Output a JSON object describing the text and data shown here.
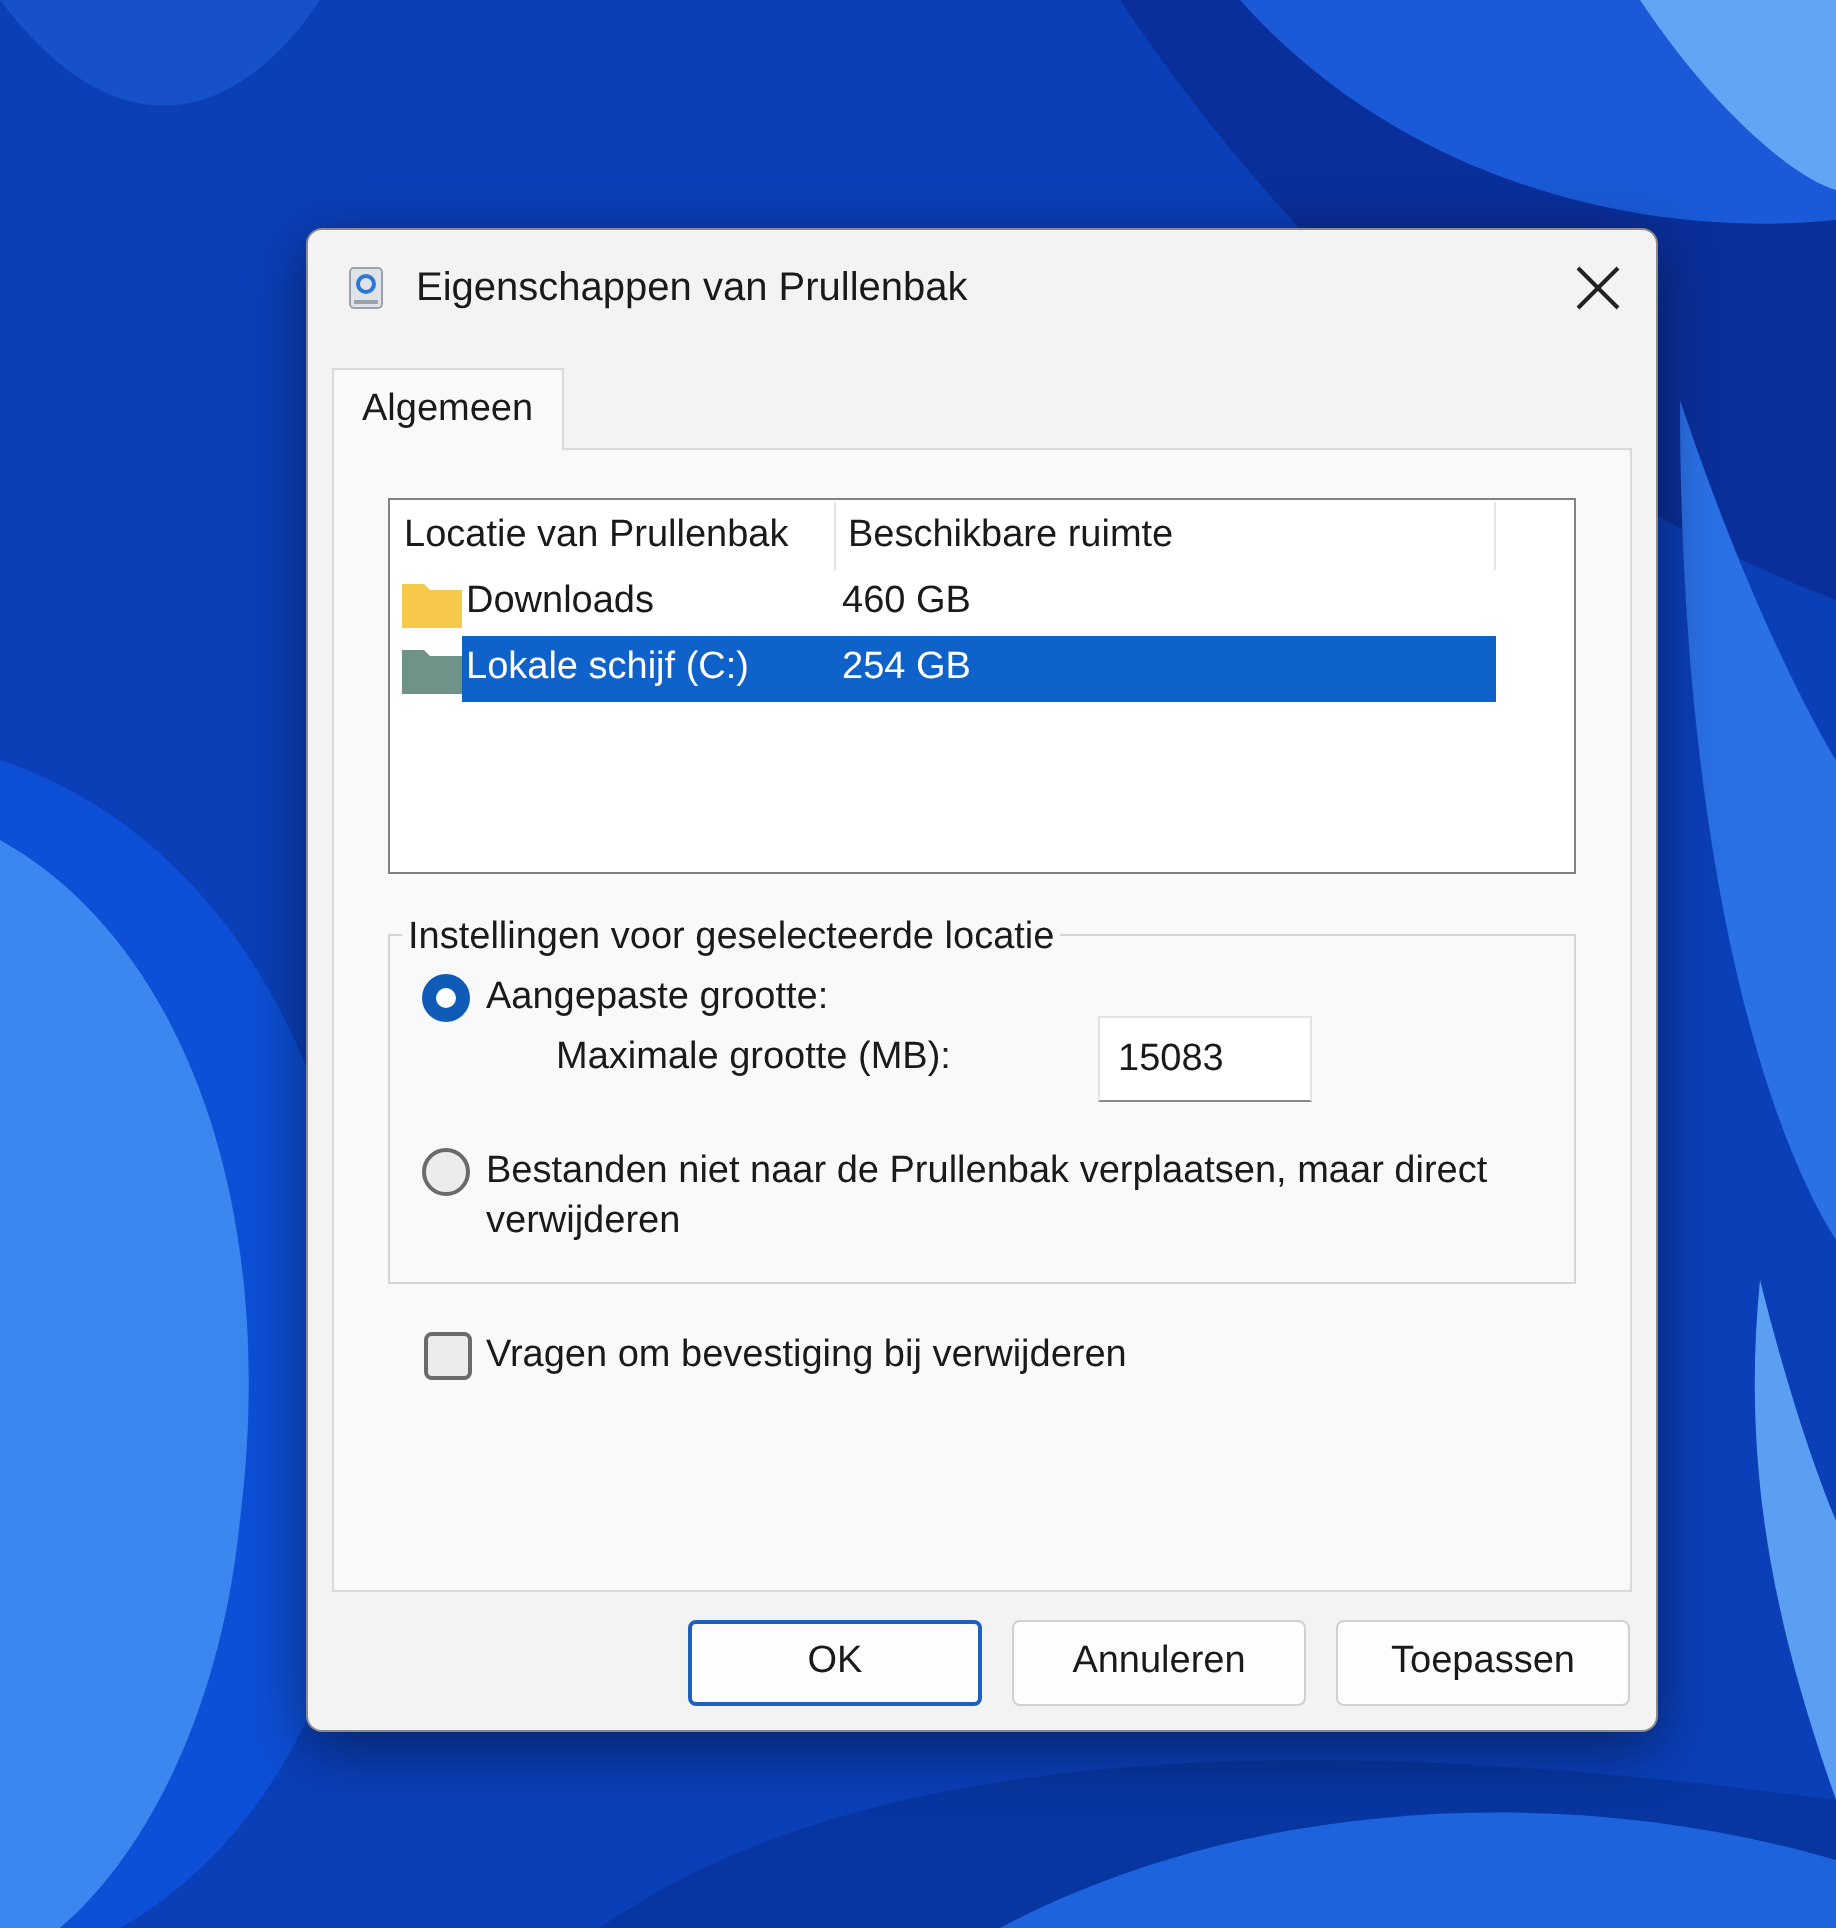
{
  "window": {
    "title": "Eigenschappen van Prullenbak"
  },
  "tabs": [
    {
      "label": "Algemeen",
      "selected": true
    }
  ],
  "list": {
    "columns": [
      "Locatie van Prullenbak",
      "Beschikbare ruimte"
    ],
    "rows": [
      {
        "name": "Downloads",
        "space": "460 GB",
        "selected": false,
        "color": "#f7c94a"
      },
      {
        "name": "Lokale schijf (C:)",
        "space": "254 GB",
        "selected": true,
        "color": "#6f9388"
      }
    ]
  },
  "settings": {
    "legend": "Instellingen voor geselecteerde locatie",
    "options": [
      {
        "label": "Aangepaste grootte:",
        "selected": true,
        "field_label": "Maximale grootte (MB):",
        "field_value": "15083"
      },
      {
        "label": "Bestanden niet naar de Prullenbak verplaatsen, maar direct verwijderen",
        "selected": false
      }
    ]
  },
  "confirm": {
    "label": "Vragen om bevestiging bij verwijderen",
    "checked": false
  },
  "buttons": [
    {
      "label": "OK",
      "default": true
    },
    {
      "label": "Annuleren",
      "default": false
    },
    {
      "label": "Toepassen",
      "default": false
    }
  ]
}
